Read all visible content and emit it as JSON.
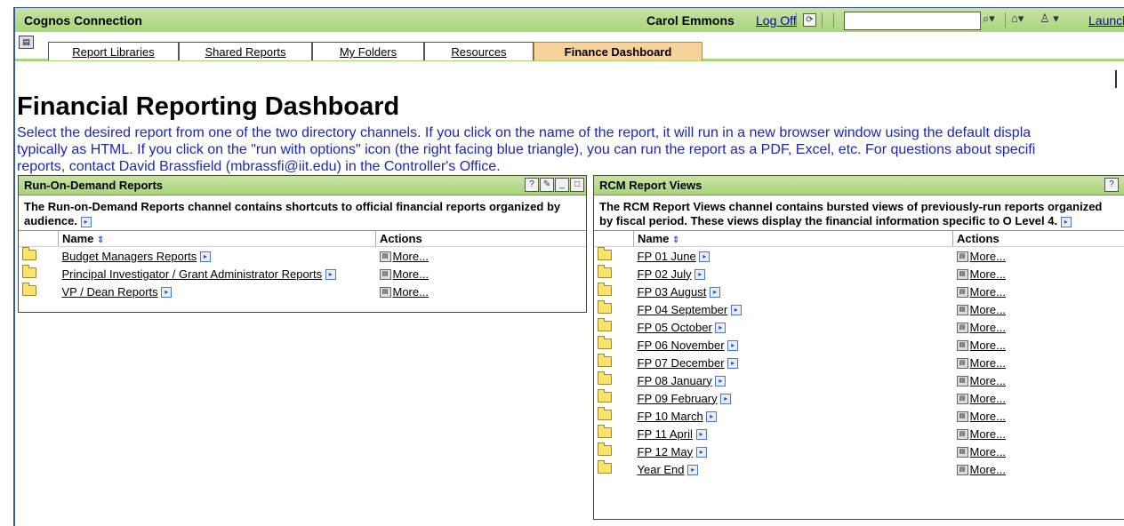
{
  "app": {
    "title": "Cognos Connection"
  },
  "user": {
    "name": "Carol Emmons",
    "logoff": "Log Off",
    "launch": "Launch",
    "search_value": ""
  },
  "tabs": [
    {
      "label": "Report Libraries"
    },
    {
      "label": "Shared Reports"
    },
    {
      "label": "My Folders"
    },
    {
      "label": "Resources"
    },
    {
      "label": "Finance Dashboard",
      "active": true
    }
  ],
  "page": {
    "heading": "Financial Reporting Dashboard",
    "intro": [
      "Select the desired report from one of the two directory channels. If you click on the name of the report, it will run in a new browser window using the default displa",
      "typically as HTML. If you click on the \"run with options\" icon (the right facing blue triangle), you can run the report as a PDF, Excel, etc. For questions about specifi",
      "reports, contact David Brassfield (mbrassfi@iit.edu) in the Controller's Office."
    ]
  },
  "left_panel": {
    "title": "Run-On-Demand Reports",
    "description": "The Run-on-Demand Reports channel contains shortcuts to official financial reports organized by audience.",
    "columns": {
      "name": "Name",
      "actions": "Actions"
    },
    "rows": [
      {
        "name": "Budget Managers Reports",
        "action": "More..."
      },
      {
        "name": "Principal Investigator / Grant Administrator Reports",
        "action": "More..."
      },
      {
        "name": "VP / Dean Reports",
        "action": "More..."
      }
    ]
  },
  "right_panel": {
    "title": "RCM Report Views",
    "description": "The RCM Report Views channel contains bursted views of previously-run reports organized by fiscal period. These views display the financial information specific to O Level 4.",
    "columns": {
      "name": "Name",
      "actions": "Actions"
    },
    "rows": [
      {
        "name": "FP 01 June",
        "action": "More..."
      },
      {
        "name": "FP 02 July",
        "action": "More..."
      },
      {
        "name": "FP 03 August",
        "action": "More..."
      },
      {
        "name": "FP 04 September",
        "action": "More..."
      },
      {
        "name": "FP 05 October",
        "action": "More..."
      },
      {
        "name": "FP 06 November",
        "action": "More..."
      },
      {
        "name": "FP 07 December",
        "action": "More..."
      },
      {
        "name": "FP 08 January",
        "action": "More..."
      },
      {
        "name": "FP 09 February",
        "action": "More..."
      },
      {
        "name": "FP 10 March",
        "action": "More..."
      },
      {
        "name": "FP 11 April",
        "action": "More..."
      },
      {
        "name": "FP 12 May",
        "action": "More..."
      },
      {
        "name": "Year End",
        "action": "More..."
      }
    ]
  },
  "colors": {
    "header_green": "#a9d57a",
    "active_tab": "#f9d29a",
    "intro_text": "#1a28b5"
  }
}
